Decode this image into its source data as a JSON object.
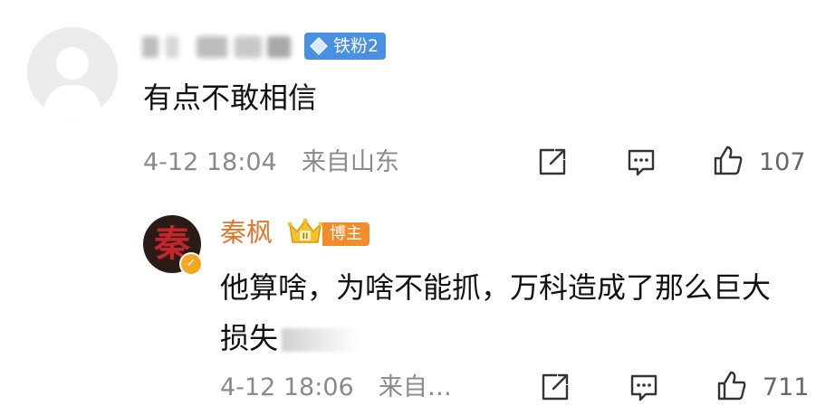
{
  "comment": {
    "username": "",
    "badge_label": "铁粉2",
    "text": "有点不敢相信",
    "timestamp": "4-12 18:04",
    "location": "来自山东",
    "like_count": "107"
  },
  "reply": {
    "username": "秦枫",
    "badge_label": "博主",
    "crown_level": "II",
    "avatar_glyph": "秦",
    "text": "他算啥，为啥不能抓，万科造成了那么巨大损失",
    "timestamp": "4-12 18:06",
    "location": "来自…",
    "like_count": "711"
  },
  "icons": {
    "share": "share-icon",
    "comment": "comment-icon",
    "like": "thumbs-up-icon",
    "verified": "verified-icon",
    "crown": "crown-icon"
  },
  "colors": {
    "reply_name": "#e2762f",
    "fan_badge": "#4a90e2",
    "host_badge": "#f18b2b",
    "meta_text": "#8a8a8a"
  }
}
